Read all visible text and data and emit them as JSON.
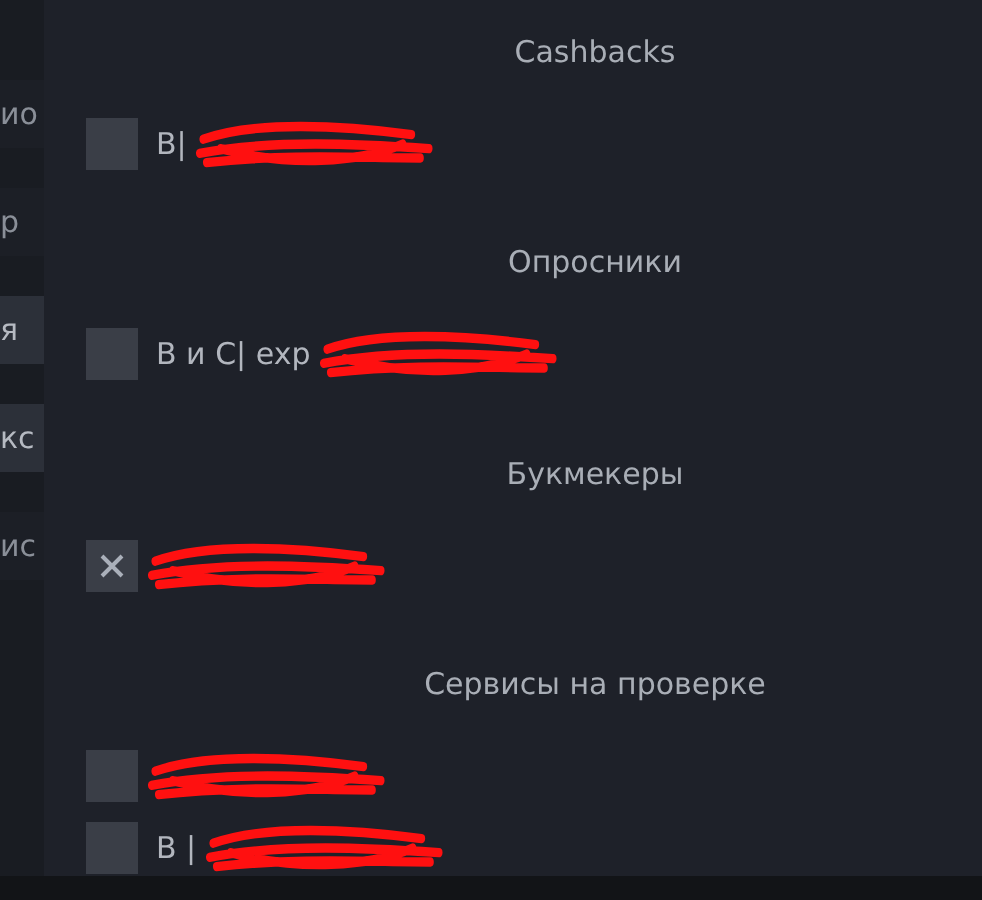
{
  "sidebar": {
    "items": [
      {
        "label": "ио",
        "selected": false
      },
      {
        "label": "р",
        "selected": false
      },
      {
        "label": "я",
        "selected": true
      },
      {
        "label": "кс",
        "selected": true
      },
      {
        "label": "ис",
        "selected": false
      }
    ]
  },
  "sections": [
    {
      "title": "Cashbacks",
      "items": [
        {
          "label": "B|",
          "checked": false,
          "redacted": true
        }
      ]
    },
    {
      "title": "Опросники",
      "items": [
        {
          "label": "B и C| exp",
          "checked": false,
          "redacted": true
        }
      ]
    },
    {
      "title": "Букмекеры",
      "items": [
        {
          "checked": true,
          "redacted": true
        }
      ]
    },
    {
      "title": "Сервисы на проверке",
      "items": [
        {
          "checked": false,
          "redacted": true
        },
        {
          "label": "B |",
          "checked": false,
          "redacted": true
        }
      ]
    }
  ]
}
